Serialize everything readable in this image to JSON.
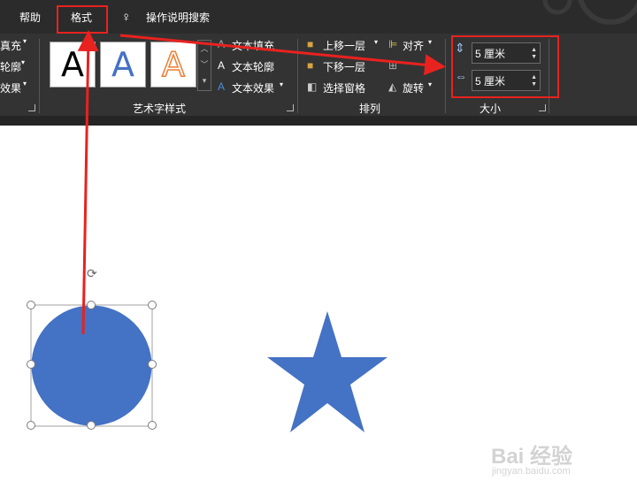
{
  "tabs": {
    "help": "帮助",
    "format": "格式",
    "search": "操作说明搜索"
  },
  "ribbon": {
    "left_items": [
      "真充",
      "轮廓",
      "效果"
    ],
    "wordart_samples": [
      "A",
      "A",
      "A"
    ],
    "wordart_commands": [
      "文本填充",
      "文本轮廓",
      "文本效果"
    ],
    "wordart_group": "艺术字样式",
    "arrange_commands": [
      "上移一层",
      "下移一层",
      "选择窗格",
      "对齐",
      "旋转"
    ],
    "arrange_group": "排列",
    "size": {
      "height": "5 厘米",
      "width": "5 厘米",
      "group": "大小"
    }
  },
  "colors": {
    "annotation_red": "#e8221f",
    "shape_blue": "#4472c4"
  },
  "watermark": {
    "brand": "Bai 经验",
    "url": "jingyan.baidu.com"
  }
}
